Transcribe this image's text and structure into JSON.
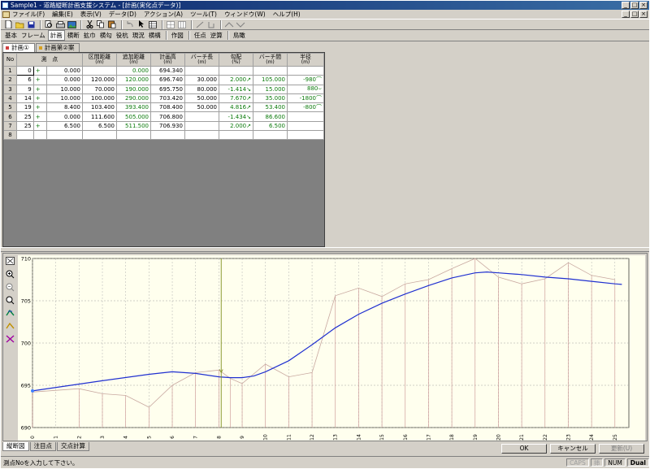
{
  "window": {
    "title": "Sample1 - 道路縦断計画支援システム - [計画(実化点データ)]",
    "controls": [
      "_",
      "□",
      "×"
    ]
  },
  "menu": [
    "ファイル(F)",
    "編集(E)",
    "表示(V)",
    "データ(D)",
    "アクション(A)",
    "ツール(T)",
    "ウィンドウ(W)",
    "ヘルプ(H)"
  ],
  "modes": [
    "基本",
    "フレーム",
    "計画",
    "横断",
    "拡巾",
    "横勾",
    "役杭",
    "現況",
    "横構",
    "作図",
    "任点",
    "逆算",
    "鳥瞰"
  ],
  "doc_tabs": [
    "計画①",
    "計画第②案"
  ],
  "grid": {
    "columns": [
      {
        "label": "No",
        "unit": ""
      },
      {
        "label": "測　点",
        "unit": ""
      },
      {
        "label": "",
        "unit": ""
      },
      {
        "label": "",
        "unit": ""
      },
      {
        "label": "区間距離",
        "unit": "(m)"
      },
      {
        "label": "追加距離",
        "unit": "(m)"
      },
      {
        "label": "計画高",
        "unit": "(m)"
      },
      {
        "label": "バーチ長",
        "unit": "(m)"
      },
      {
        "label": "勾配",
        "unit": "(%)"
      },
      {
        "label": "バーチ間",
        "unit": "(m)"
      },
      {
        "label": "半径",
        "unit": "(m)"
      }
    ],
    "rows": [
      {
        "no": "1",
        "sta": "0",
        "plus": "+",
        "add": "0.000",
        "seg": "",
        "cum": "0.000",
        "elev": "694.340",
        "vcl": "",
        "grade": "",
        "garrow": "",
        "vdist": "",
        "radius": "",
        "rarrow": ""
      },
      {
        "no": "2",
        "sta": "6",
        "plus": "+",
        "add": "0.000",
        "seg": "120.000",
        "cum": "120.000",
        "elev": "696.740",
        "vcl": "30.000",
        "grade": "2.000",
        "garrow": "↗",
        "vdist": "105.000",
        "radius": "-980",
        "rarrow": "⌒"
      },
      {
        "no": "3",
        "sta": "9",
        "plus": "+",
        "add": "10.000",
        "seg": "70.000",
        "cum": "190.000",
        "elev": "695.750",
        "vcl": "80.000",
        "grade": "-1.414",
        "garrow": "↘",
        "vdist": "15.000",
        "radius": "880",
        "rarrow": "⌣"
      },
      {
        "no": "4",
        "sta": "14",
        "plus": "+",
        "add": "10.000",
        "seg": "100.000",
        "cum": "290.000",
        "elev": "703.420",
        "vcl": "50.000",
        "grade": "7.670",
        "garrow": "↗",
        "vdist": "35.000",
        "radius": "-1800",
        "rarrow": "⌒"
      },
      {
        "no": "5",
        "sta": "19",
        "plus": "+",
        "add": "8.400",
        "seg": "103.400",
        "cum": "393.400",
        "elev": "708.400",
        "vcl": "50.000",
        "grade": "4.816",
        "garrow": "↗",
        "vdist": "53.400",
        "radius": "-800",
        "rarrow": "⌒"
      },
      {
        "no": "6",
        "sta": "25",
        "plus": "+",
        "add": "0.000",
        "seg": "111.600",
        "cum": "505.000",
        "elev": "706.800",
        "vcl": "",
        "grade": "-1.434",
        "garrow": "↘",
        "vdist": "86.600",
        "radius": "",
        "rarrow": ""
      },
      {
        "no": "7",
        "sta": "25",
        "plus": "+",
        "add": "6.500",
        "seg": "6.500",
        "cum": "511.500",
        "elev": "706.930",
        "vcl": "",
        "grade": "2.000",
        "garrow": "↗",
        "vdist": "6.500",
        "radius": "",
        "rarrow": ""
      },
      {
        "no": "8",
        "sta": "",
        "plus": "",
        "add": "",
        "seg": "",
        "cum": "",
        "elev": "",
        "vcl": "",
        "grade": "",
        "garrow": "",
        "vdist": "",
        "radius": "",
        "rarrow": ""
      }
    ]
  },
  "chart_data": {
    "type": "line",
    "y_ticks": [
      "690",
      "695",
      "700",
      "705",
      "710"
    ],
    "ylim": [
      690,
      710
    ],
    "x_ticks": [
      "0",
      "1",
      "2",
      "3",
      "4",
      "5",
      "6",
      "7",
      "8",
      "9",
      "10",
      "11",
      "12",
      "13",
      "14",
      "15",
      "16",
      "17",
      "18",
      "19",
      "20",
      "21",
      "22",
      "23",
      "24",
      "25"
    ],
    "xlim": [
      0,
      25.6
    ],
    "plan_line": {
      "x": [
        0,
        3,
        5,
        6,
        7,
        8,
        8.5,
        9,
        9.5,
        10,
        11,
        12,
        13,
        14,
        15,
        16,
        17,
        18,
        19,
        19.5,
        20,
        21,
        22,
        23,
        24,
        25,
        25.3
      ],
      "y": [
        694.34,
        695.54,
        696.3,
        696.6,
        696.4,
        696.0,
        695.9,
        695.9,
        696.1,
        696.6,
        697.9,
        699.8,
        701.8,
        703.4,
        704.7,
        705.8,
        706.8,
        707.7,
        708.3,
        708.4,
        708.3,
        708.1,
        707.8,
        707.6,
        707.3,
        707.0,
        706.93
      ]
    },
    "ground_line": {
      "x": [
        0,
        2,
        3,
        4,
        5,
        6,
        7,
        8,
        8.5,
        9,
        10,
        11,
        12,
        13,
        14,
        15,
        16,
        17,
        18,
        19,
        20,
        21,
        22,
        23,
        24,
        25
      ],
      "y": [
        694.2,
        694.6,
        694.0,
        693.8,
        692.4,
        695.0,
        696.5,
        696.8,
        695.8,
        695.2,
        697.5,
        696.0,
        696.5,
        705.6,
        706.5,
        705.5,
        707.0,
        707.5,
        708.8,
        710.0,
        707.8,
        707.0,
        707.6,
        709.5,
        708.0,
        707.5
      ]
    },
    "cursor_station": 8.1,
    "grid": true
  },
  "bottom_tabs": [
    "縦断図",
    "注目点",
    "交点計算"
  ],
  "buttons": {
    "ok": "OK",
    "cancel": "キャンセル",
    "update": "更新(U)"
  },
  "status": {
    "message": "測点Noを入力して下さい。",
    "caps": "CAPS",
    "ins": "挿",
    "num": "NUM",
    "mode": "Dual"
  }
}
